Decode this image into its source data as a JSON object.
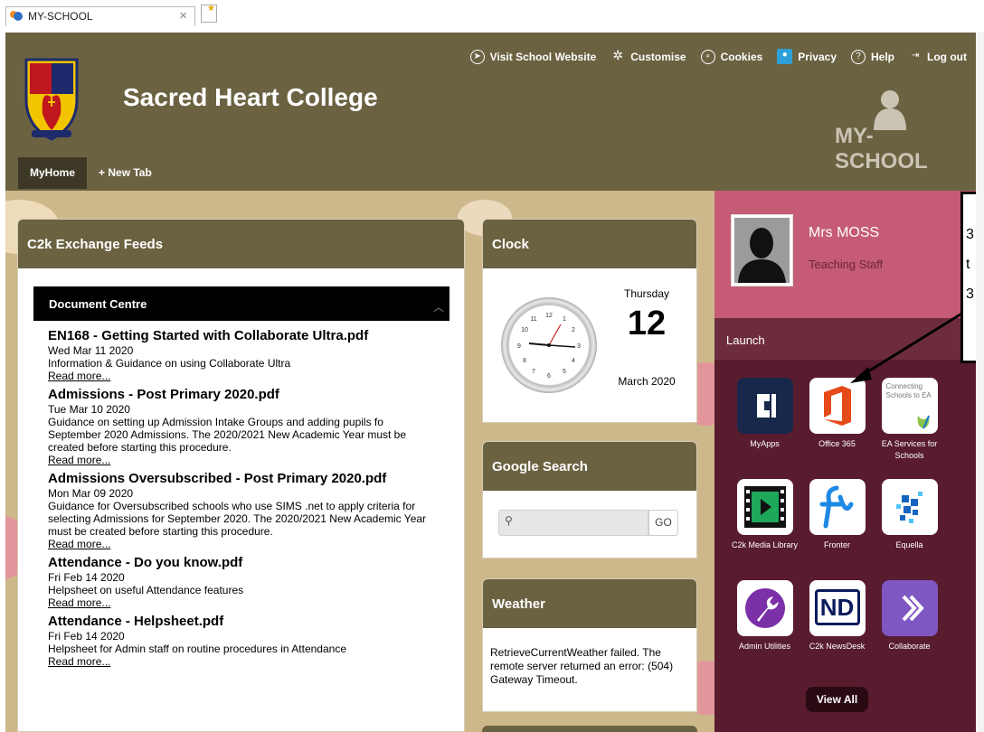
{
  "browser": {
    "tab_title": "MY-SCHOOL",
    "close_glyph": "×"
  },
  "topnav": {
    "visit_website": "Visit School Website",
    "customise": "Customise",
    "cookies": "Cookies",
    "privacy": "Privacy",
    "help": "Help",
    "logout": "Log out"
  },
  "header": {
    "school_name": "Sacred Heart College",
    "logo_text": "MY-SCHOOL"
  },
  "page_tabs": {
    "myhome": "MyHome",
    "new_tab": "+ New Tab"
  },
  "feeds": {
    "title": "C2k Exchange Feeds",
    "section": "Document Centre",
    "items": [
      {
        "title": "EN168 - Getting Started with Collaborate Ultra.pdf",
        "date": "Wed Mar 11 2020",
        "desc": "Information & Guidance on using Collaborate Ultra",
        "more": "Read more..."
      },
      {
        "title": "Admissions - Post Primary 2020.pdf",
        "date": "Tue Mar 10 2020",
        "desc": "Guidance on setting up Admission Intake Groups and adding pupils fo September 2020 Admissions. The 2020/2021 New Academic Year must be created before starting this procedure.",
        "more": "Read more..."
      },
      {
        "title": "Admissions Oversubscribed - Post Primary 2020.pdf",
        "date": "Mon Mar 09 2020",
        "desc": "Guidance for Oversubscribed schools who use SIMS .net to apply criteria for selecting Admissions for September 2020. The 2020/2021 New Academic Year must be created before starting this procedure.",
        "more": "Read more..."
      },
      {
        "title": "Attendance - Do you know.pdf",
        "date": "Fri Feb 14 2020",
        "desc": "Helpsheet on useful Attendance features",
        "more": "Read more..."
      },
      {
        "title": "Attendance - Helpsheet.pdf",
        "date": "Fri Feb 14 2020",
        "desc": "Helpsheet for Admin staff on routine procedures in Attendance",
        "more": "Read more..."
      }
    ]
  },
  "clock": {
    "title": "Clock",
    "day": "Thursday",
    "date": "12",
    "month": "March 2020"
  },
  "search": {
    "title": "Google Search",
    "placeholder": "",
    "go": "GO"
  },
  "weather": {
    "title": "Weather",
    "message": "RetrieveCurrentWeather failed. The remote server returned an error: (504) Gateway Timeout."
  },
  "user": {
    "name": "Mrs MOSS",
    "role": "Teaching Staff"
  },
  "launch": {
    "title": "Launch",
    "apps": [
      {
        "label": "MyApps",
        "icon": "myapps-icon"
      },
      {
        "label": "Office 365",
        "icon": "office365-icon"
      },
      {
        "label": "EA Services for Schools",
        "icon": "ea-services-icon",
        "tile_text": "Connecting Schools to EA"
      },
      {
        "label": "C2k Media Library",
        "icon": "media-library-icon"
      },
      {
        "label": "Fronter",
        "icon": "fronter-icon"
      },
      {
        "label": "Equella",
        "icon": "equella-icon"
      },
      {
        "label": "Admin Utilities",
        "icon": "admin-utilities-icon"
      },
      {
        "label": "C2k NewsDesk",
        "icon": "newsdesk-icon",
        "tile_text": "ND"
      },
      {
        "label": "Collaborate",
        "icon": "collaborate-icon"
      }
    ],
    "view_all": "View All"
  },
  "callout": {
    "lines": [
      "3",
      "t",
      "3"
    ]
  },
  "colors": {
    "header": "#6b6242",
    "user_card": "#c55b74",
    "launch": "#591c2f",
    "wallpaper": "#cdb88c"
  }
}
